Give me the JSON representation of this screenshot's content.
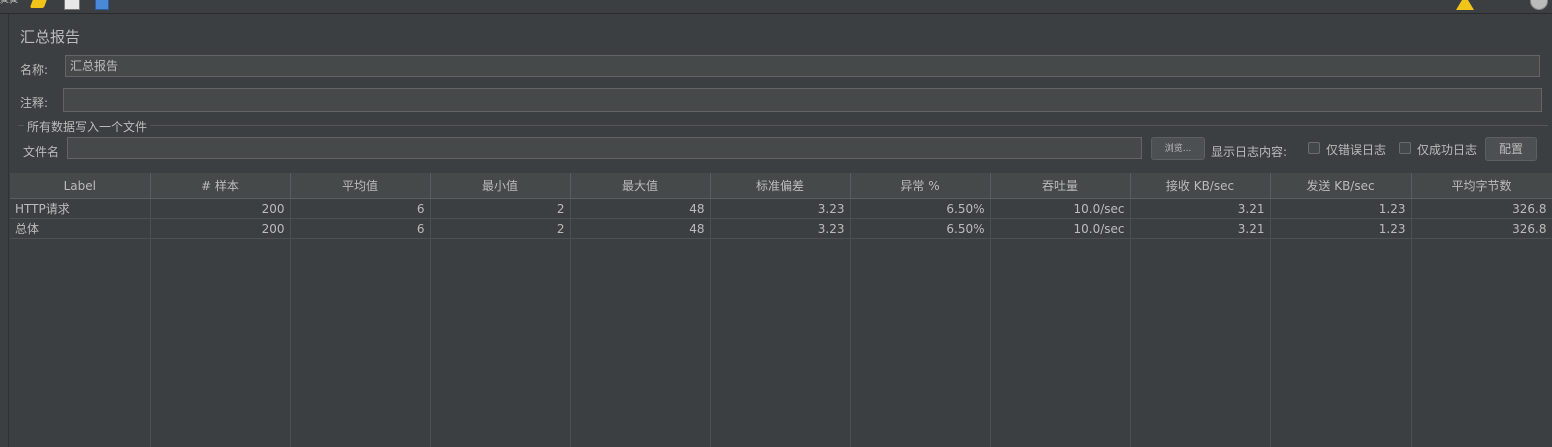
{
  "toolbar": {
    "icons": [
      "scissors-icon",
      "brush-icon",
      "document-icon",
      "save-icon"
    ],
    "right_icons": [
      "warning-icon",
      "globe-icon"
    ]
  },
  "panel": {
    "title": "汇总报告",
    "name_label": "名称:",
    "name_value": "汇总报告",
    "comment_label": "注释:",
    "comment_value": "",
    "file_group_title": "所有数据写入一个文件",
    "file_label": "文件名",
    "file_value": "",
    "browse_button": "浏览...",
    "log_content_label": "显示日志内容:",
    "errors_only_label": "仅错误日志",
    "success_only_label": "仅成功日志",
    "configure_button": "配置"
  },
  "table": {
    "columns": [
      "Label",
      "# 样本",
      "平均值",
      "最小值",
      "最大值",
      "标准偏差",
      "异常 %",
      "吞吐量",
      "接收 KB/sec",
      "发送 KB/sec",
      "平均字节数"
    ],
    "rows": [
      [
        "HTTP请求",
        "200",
        "6",
        "2",
        "48",
        "3.23",
        "6.50%",
        "10.0/sec",
        "3.21",
        "1.23",
        "326.8"
      ],
      [
        "总体",
        "200",
        "6",
        "2",
        "48",
        "3.23",
        "6.50%",
        "10.0/sec",
        "3.21",
        "1.23",
        "326.8"
      ]
    ]
  },
  "colors": {
    "background": "#3c3f41",
    "field_background": "#45494a",
    "text": "#bbbbbb",
    "warning": "#f0c419"
  }
}
